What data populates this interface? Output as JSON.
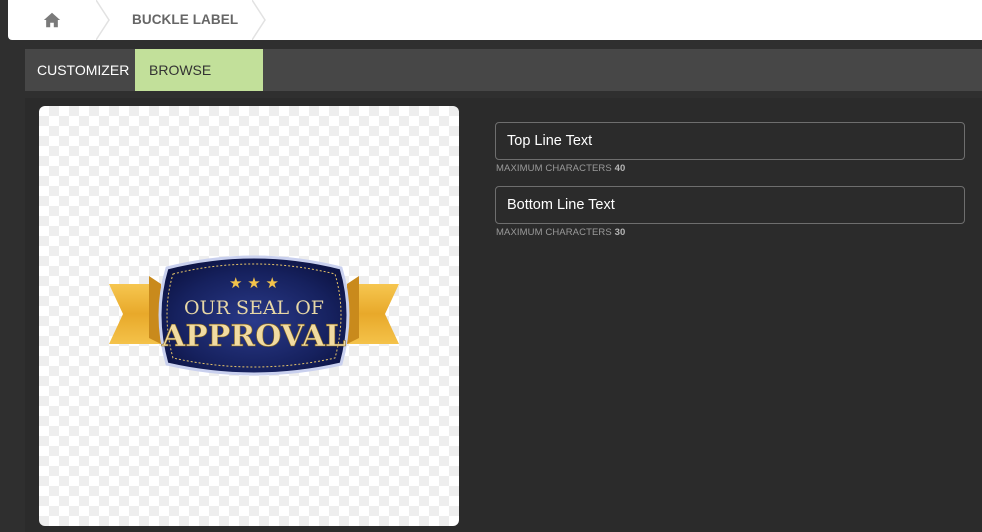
{
  "breadcrumb": {
    "home_icon": "home-icon",
    "current": "BUCKLE LABEL"
  },
  "tabs": [
    {
      "label": "CUSTOMIZER",
      "active": false
    },
    {
      "label": "BROWSE ITEMS",
      "active": true
    }
  ],
  "colors": {
    "tab_active_bg": "#c2e09a",
    "badge_navy": "#141f5a",
    "badge_gold": "#f0b93a"
  },
  "preview": {
    "badge": {
      "line1": "OUR SEAL OF",
      "line2": "APPROVAL",
      "stars": "★ ★ ★"
    }
  },
  "form": {
    "top_line": {
      "placeholder": "Top Line Text",
      "hint_label": "MAXIMUM CHARACTERS",
      "max": "40"
    },
    "bottom_line": {
      "placeholder": "Bottom Line Text",
      "hint_label": "MAXIMUM CHARACTERS",
      "max": "30"
    }
  }
}
